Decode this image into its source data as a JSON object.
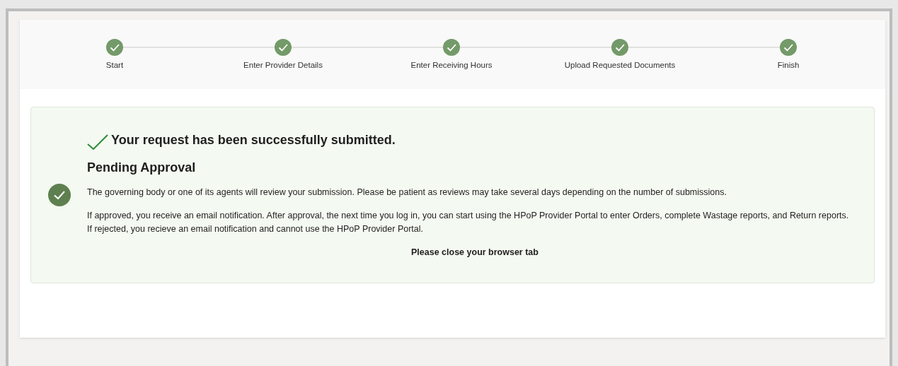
{
  "steps": [
    {
      "label": "Start",
      "completed": true
    },
    {
      "label": "Enter Provider Details",
      "completed": true
    },
    {
      "label": "Enter Receiving Hours",
      "completed": true
    },
    {
      "label": "Upload Requested Documents",
      "completed": true
    },
    {
      "label": "Finish",
      "completed": true
    }
  ],
  "result": {
    "title": "Your request has been successfully submitted.",
    "heading": "Pending Approval",
    "paragraphs": [
      "The governing body or one of its agents will review your submission. Please be patient as reviews may take several days depending on the number of submissions."
    ],
    "lines": [
      "If approved, you receive an email notification. After approval, the next time you log in, you can start using the HPoP Provider Portal to enter Orders, complete Wastage reports, and Return reports.",
      "If rejected, you recieve an email notification and cannot use the HPoP Provider Portal."
    ],
    "closing": "Please close your browser tab"
  }
}
